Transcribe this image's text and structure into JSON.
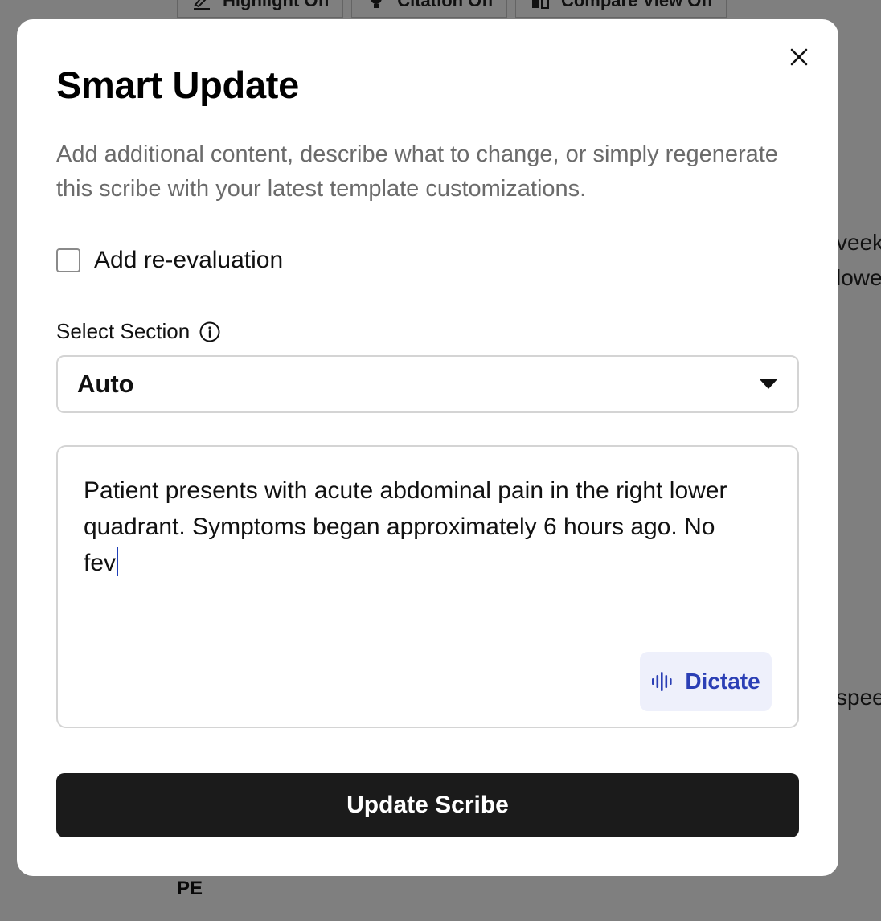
{
  "background": {
    "toolbar": [
      {
        "label": "Highlight Off",
        "icon": "highlighter-icon"
      },
      {
        "label": "Citation Off",
        "icon": "lightbulb-icon"
      },
      {
        "label": "Compare View Off",
        "icon": "compare-icon"
      }
    ],
    "text_fragments": [
      "veek",
      "lowe",
      "spee"
    ],
    "section_heading": "PE"
  },
  "modal": {
    "title": "Smart Update",
    "description": "Add additional content, describe what to change, or simply regenerate this scribe with your latest template customizations.",
    "close_icon": "close-icon",
    "reevaluation": {
      "label": "Add re-evaluation",
      "checked": false
    },
    "section_select": {
      "label": "Select Section",
      "info_icon": "info-icon",
      "value": "Auto",
      "caret_icon": "caret-down-icon"
    },
    "note_input": {
      "value": "Patient presents with acute abdominal pain in the right lower quadrant. Symptoms began approximately 6 hours ago. No fev"
    },
    "dictate_button": {
      "label": "Dictate",
      "icon": "waveform-icon"
    },
    "submit_button": {
      "label": "Update Scribe"
    }
  },
  "colors": {
    "accent": "#2b3fb5",
    "accent_bg": "#eef0fb",
    "primary_button": "#1b1b1b",
    "overlay": "rgba(0,0,0,0.5)"
  }
}
